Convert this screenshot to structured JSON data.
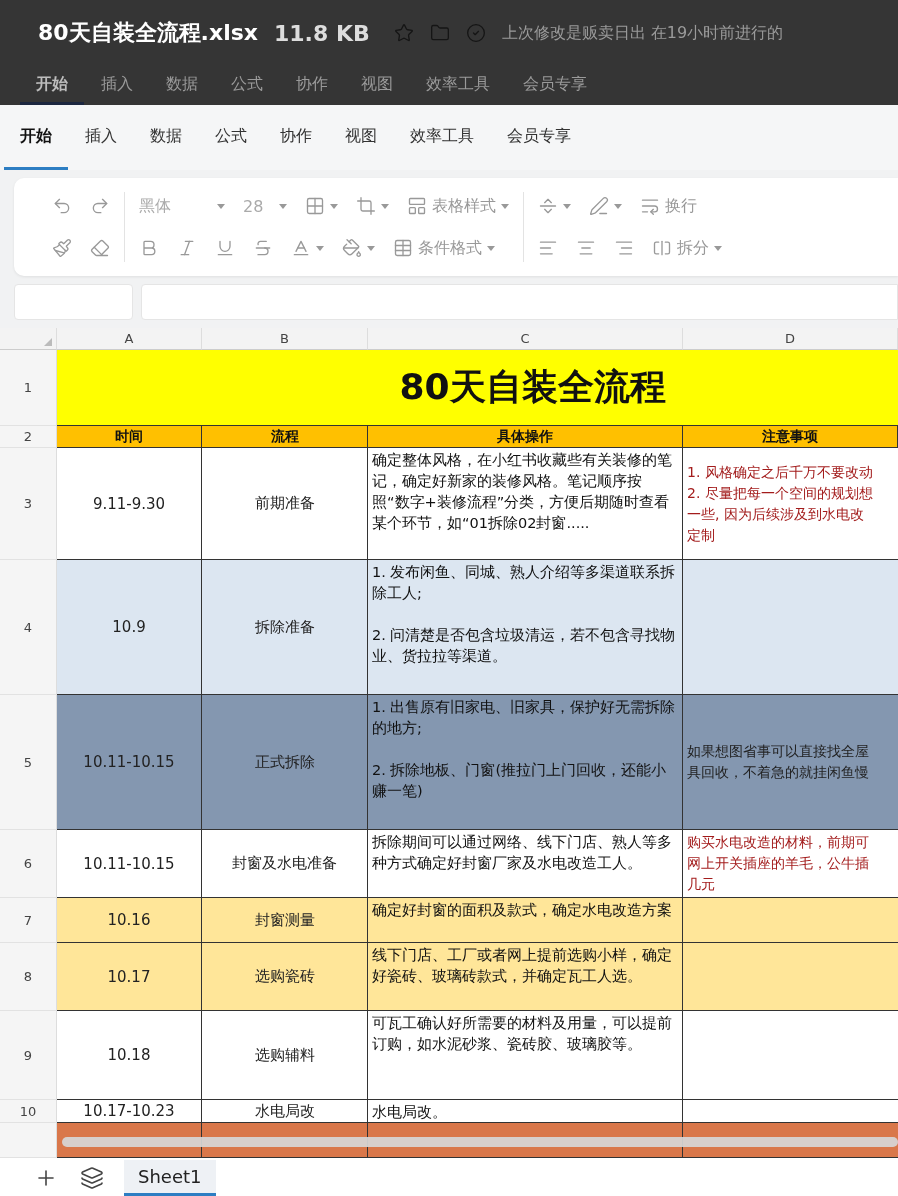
{
  "overlay_title": {
    "file_name": "80天自装全流程.xlsx",
    "size": "11.8 KB"
  },
  "dim_header": {
    "last_modified": "上次修改是贩卖日出 在19小时前进行的",
    "tabs": [
      {
        "label": "开始",
        "selected": true
      },
      {
        "label": "插入",
        "selected": false
      },
      {
        "label": "数据",
        "selected": false
      },
      {
        "label": "公式",
        "selected": false
      },
      {
        "label": "协作",
        "selected": false
      },
      {
        "label": "视图",
        "selected": false
      },
      {
        "label": "效率工具",
        "selected": false
      },
      {
        "label": "会员专享",
        "selected": false
      }
    ]
  },
  "tabs": [
    {
      "label": "开始",
      "selected": true
    },
    {
      "label": "插入",
      "selected": false
    },
    {
      "label": "数据",
      "selected": false
    },
    {
      "label": "公式",
      "selected": false
    },
    {
      "label": "协作",
      "selected": false
    },
    {
      "label": "视图",
      "selected": false
    },
    {
      "label": "效率工具",
      "selected": false
    },
    {
      "label": "会员专享",
      "selected": false
    }
  ],
  "toolbar": {
    "font": "黑体",
    "font_size": "28",
    "table_style": "表格样式",
    "conditional_format": "条件格式",
    "wrap": "换行",
    "split": "拆分"
  },
  "sheet": {
    "columns": [
      "A",
      "B",
      "C",
      "D"
    ],
    "title_row_number": "1",
    "title": "80天自装全流程",
    "header_row_number": "2",
    "header": [
      "时间",
      "流程",
      "具体操作",
      "注意事项"
    ],
    "rows": [
      {
        "number": "3",
        "color": "#ffffff",
        "time": "9.11-9.30",
        "step": "前期准备",
        "detail": "确定整体风格，在小红书收藏些有关装修的笔记，确定好新家的装修风格。笔记顺序按照“数字+装修流程”分类，方便后期随时查看某个环节，如“01拆除02封窗.....",
        "notes": [
          "1. 风格确定之后千万不要改动",
          "2. 尽量把每一个空间的规划想",
          "一些, 因为后续涉及到水电改",
          "定制"
        ],
        "notes_emphasis": true
      },
      {
        "number": "4",
        "color": "#dce6f1",
        "time": "10.9",
        "step": "拆除准备",
        "detail": "1. 发布闲鱼、同城、熟人介绍等多渠道联系拆除工人;\n\n2. 问清楚是否包含垃圾清运，若不包含寻找物业、货拉拉等渠道。"
      },
      {
        "number": "5",
        "color": "#8497b0",
        "time": "10.11-10.15",
        "step": "正式拆除",
        "detail": "1. 出售原有旧家电、旧家具，保护好无需拆除的地方;\n\n2. 拆除地板、门窗(推拉门上门回收，还能小赚一笔)",
        "notes": [
          "如果想图省事可以直接找全屋",
          "具回收，不着急的就挂闲鱼慢"
        ],
        "notes_emphasis": false
      },
      {
        "number": "6",
        "color": "#ffffff",
        "time": "10.11-10.15",
        "step": "封窗及水电准备",
        "detail": "拆除期间可以通过网络、线下门店、熟人等多种方式确定好封窗厂家及水电改造工人。",
        "notes": [
          "购买水电改造的材料，前期可",
          "网上开关插座的羊毛，公牛插",
          "几元"
        ],
        "notes_emphasis": true
      },
      {
        "number": "7",
        "color": "#ffe699",
        "time": "10.16",
        "step": "封窗测量",
        "detail": "确定好封窗的面积及款式，确定水电改造方案"
      },
      {
        "number": "8",
        "color": "#ffe699",
        "time": "10.17",
        "step": "选购瓷砖",
        "detail": "线下门店、工厂或者网上提前选购小样，确定好瓷砖、玻璃砖款式，并确定瓦工人选。"
      },
      {
        "number": "9",
        "color": "#ffffff",
        "time": "10.18",
        "step": "选购辅料",
        "detail": "可瓦工确认好所需要的材料及用量，可以提前订购，如水泥砂浆、瓷砖胶、玻璃胶等。"
      },
      {
        "number": "10",
        "color": "#ffffff",
        "time": "10.17-10.23",
        "step": "水电局改",
        "detail": "水电局改。"
      },
      {
        "color": "#d9774a"
      }
    ]
  },
  "sheet_tabs": [
    {
      "label": "Sheet1",
      "selected": true
    }
  ]
}
